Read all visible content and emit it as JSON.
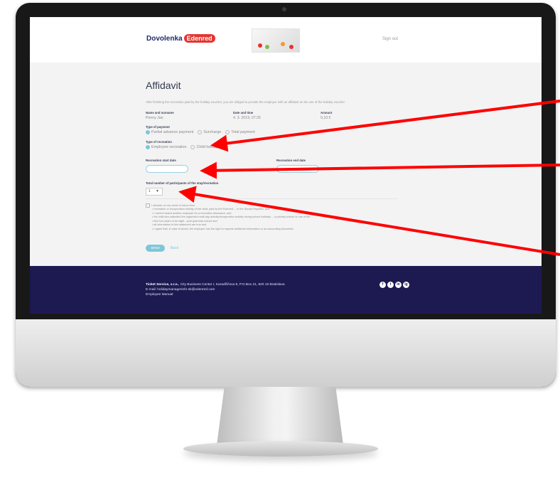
{
  "header": {
    "logo_text": "Dovolenka",
    "logo_badge": "Edenred",
    "sign_out": "Sign out"
  },
  "form": {
    "title": "Affidavit",
    "intro": "After finishing the recreation paid by the holiday voucher, you are obliged to provide the employer with an affidavit on the use of the holiday voucher.",
    "name_label": "Name and surname",
    "name_value": "Penny Jan",
    "date_label": "Date and time",
    "date_value": "4. 3. 2019, 07:25",
    "amount_label": "Amount",
    "amount_value": "0,10 €",
    "payment_label": "Type of payment",
    "payment_options": [
      "Partial advance payment",
      "Surcharge",
      "Total payment"
    ],
    "recreation_label": "Type of recreation",
    "recreation_options": [
      "Employee recreation",
      "Child holiday"
    ],
    "start_label": "Recreation start date",
    "end_label": "Recreation end date",
    "participants_label": "Total number of participants of the stay/recreation",
    "participants_value": "1",
    "declare_text": "I declare on my word of honor that",
    "declare_items": [
      "recreation or recuperation activity of the child, paid by the Edenred ... in the Slovak Republic, and",
      "I haven't asked another employer for a recreation allowance, and",
      "the child who attended the organized multi-day activity/recuperation activity during school holidays ... a primary school or one of the",
      "first four years of an eight - year grammar school and",
      "all information in this statement are true and",
      "I agree that, in case of doubt, the employer has the right to request additional information or an accounting document."
    ],
    "send_label": "SEND",
    "back_label": "Back"
  },
  "footer": {
    "company": "Ticket Service, s.r.o.",
    "address": ", City Business Center I, Karadžičova 8, P.O.Box 21, 820 15 Bratislava",
    "email": "E-mail: holidaymanagerinfo-sk@edenred.com",
    "manual": "Employee Manual"
  },
  "social": [
    "f",
    "t",
    "in",
    "ig"
  ],
  "colors": {
    "accent": "#7ec6d9",
    "footer_bg": "#1d1a52",
    "brand_red": "#e5342f",
    "arrow": "#ff0000"
  }
}
